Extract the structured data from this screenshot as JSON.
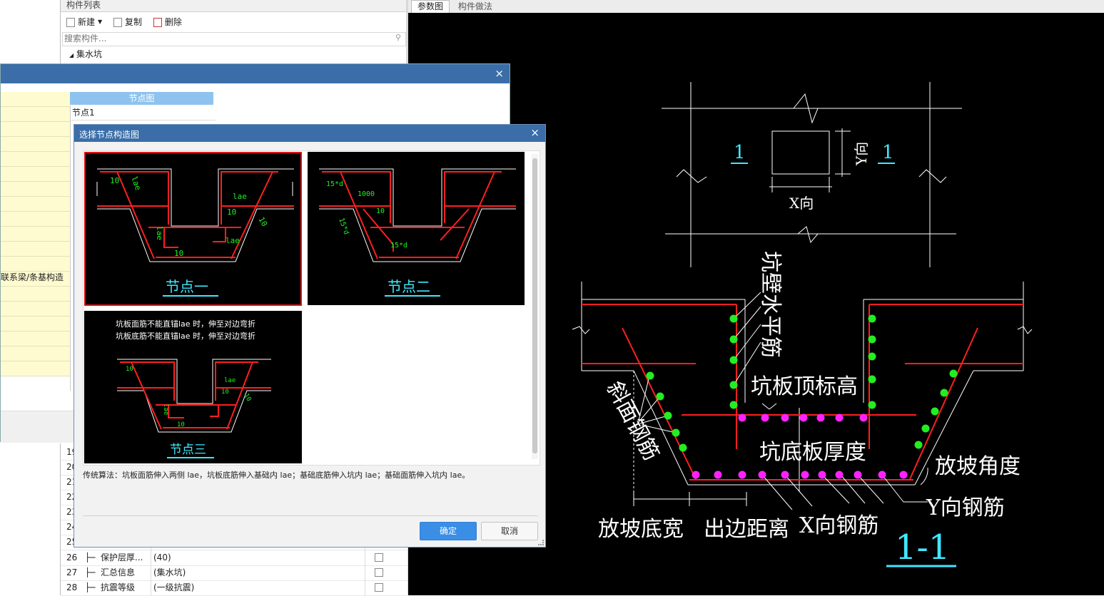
{
  "left_blank": {},
  "component_list": {
    "title": "构件列表",
    "new_label": "新建",
    "copy_label": "复制",
    "delete_label": "删除",
    "search_placeholder": "搜索构件...",
    "tree_root": "集水坑"
  },
  "right_tabs": {
    "tab1": "参数图",
    "tab2": "构件做法"
  },
  "back_dialog": {
    "column_header": "节点图",
    "first_cell": "节点1",
    "truncated_text": "联系梁/条基构造"
  },
  "property_rows": [
    {
      "no": "19"
    },
    {
      "no": "20"
    },
    {
      "no": "21"
    },
    {
      "no": "22"
    },
    {
      "no": "23"
    },
    {
      "no": "24"
    },
    {
      "no": "25"
    },
    {
      "no": "26",
      "name": "保护层厚...",
      "value": "(40)"
    },
    {
      "no": "27",
      "name": "汇总信息",
      "value": "(集水坑)"
    },
    {
      "no": "28",
      "name": "抗震等级",
      "value": "(一级抗震)"
    }
  ],
  "dialog": {
    "title": "选择节点构造图",
    "close_glyph": "×",
    "option1_caption": "节点一",
    "option2_caption": "节点二",
    "option3_caption": "节点三",
    "option3_note1": "坑板面筋不能直锚lae 时，伸至对边弯折",
    "option3_note2": "坑板底筋不能直锚lae 时，伸至对边弯折",
    "description": "传统算法：坑板面筋伸入两侧 lae，坑板底筋伸入基础内 lae；基础底筋伸入坑内 lae；基础面筋伸入坑内 lae。",
    "ok_label": "确定",
    "cancel_label": "取消",
    "lae": "lae",
    "ten": "10",
    "d15": "15*d",
    "n1000": "1000"
  },
  "diagram": {
    "section_mark": "1",
    "y_dir": "Y向",
    "x_dir": "X向",
    "wall_horizontal_rebar": "坑壁水平筋",
    "slab_top_elevation": "坑板顶标高",
    "slope_rebar": "斜面钢筋",
    "bottom_slab_thickness": "坑底板厚度",
    "slope_angle": "放坡角度",
    "y_rebar": "Y向钢筋",
    "slope_bottom_width": "放坡底宽",
    "edge_distance": "出边距离",
    "x_rebar": "X向钢筋",
    "section_label": "1-1"
  },
  "colors": {
    "cad_bg": "#000000",
    "rebar_red": "#ff1f1f",
    "green_dot": "#22ee22",
    "magenta_dot": "#ff22ff",
    "cyan": "#3fe8ff",
    "dialog_header": "#3b6ea8",
    "selected_border": "#e01010",
    "ok_blue": "#3a8ee6"
  }
}
